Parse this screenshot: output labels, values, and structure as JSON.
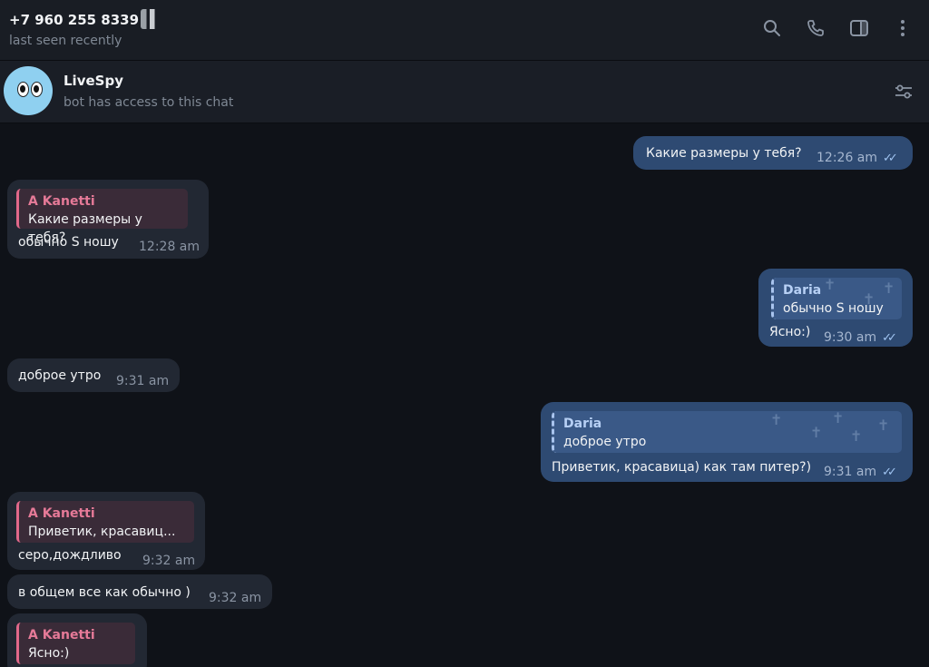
{
  "header": {
    "contact_name": "+7 960 255 8339",
    "status": "last seen recently"
  },
  "icons": [
    "search-icon",
    "phone-icon",
    "sidebar-toggle-icon",
    "more-vertical-icon",
    "settings-sliders-icon"
  ],
  "bot": {
    "name": "LiveSpy",
    "description": "bot has access to this chat"
  },
  "messages": [
    {
      "dir": "out",
      "text": "Какие размеры у тебя?",
      "time": "12:26 am",
      "read": true
    },
    {
      "dir": "in",
      "reply_name": "A Kanetti",
      "reply_text": "Какие размеры у тебя?",
      "text": "обычно S ношу",
      "time": "12:28 am"
    },
    {
      "dir": "out",
      "reply_name": "Daria",
      "reply_text": "обычно S ношу",
      "text": "Ясно:)",
      "time": "9:30 am",
      "read": true
    },
    {
      "dir": "in",
      "text": "доброе утро",
      "time": "9:31 am"
    },
    {
      "dir": "out",
      "reply_name": "Daria",
      "reply_text": "доброе утро",
      "text": "Приветик, красавица) как там питер?)",
      "time": "9:31 am",
      "read": true
    },
    {
      "dir": "in",
      "reply_name": "A Kanetti",
      "reply_text": "Приветик, красавиц...",
      "text": "серо,дождливо",
      "time": "9:32 am"
    },
    {
      "dir": "in",
      "text": "в общем все как обычно )",
      "time": "9:32 am"
    },
    {
      "dir": "in",
      "reply_name": "A Kanetti",
      "reply_text": "Ясно:)"
    }
  ]
}
